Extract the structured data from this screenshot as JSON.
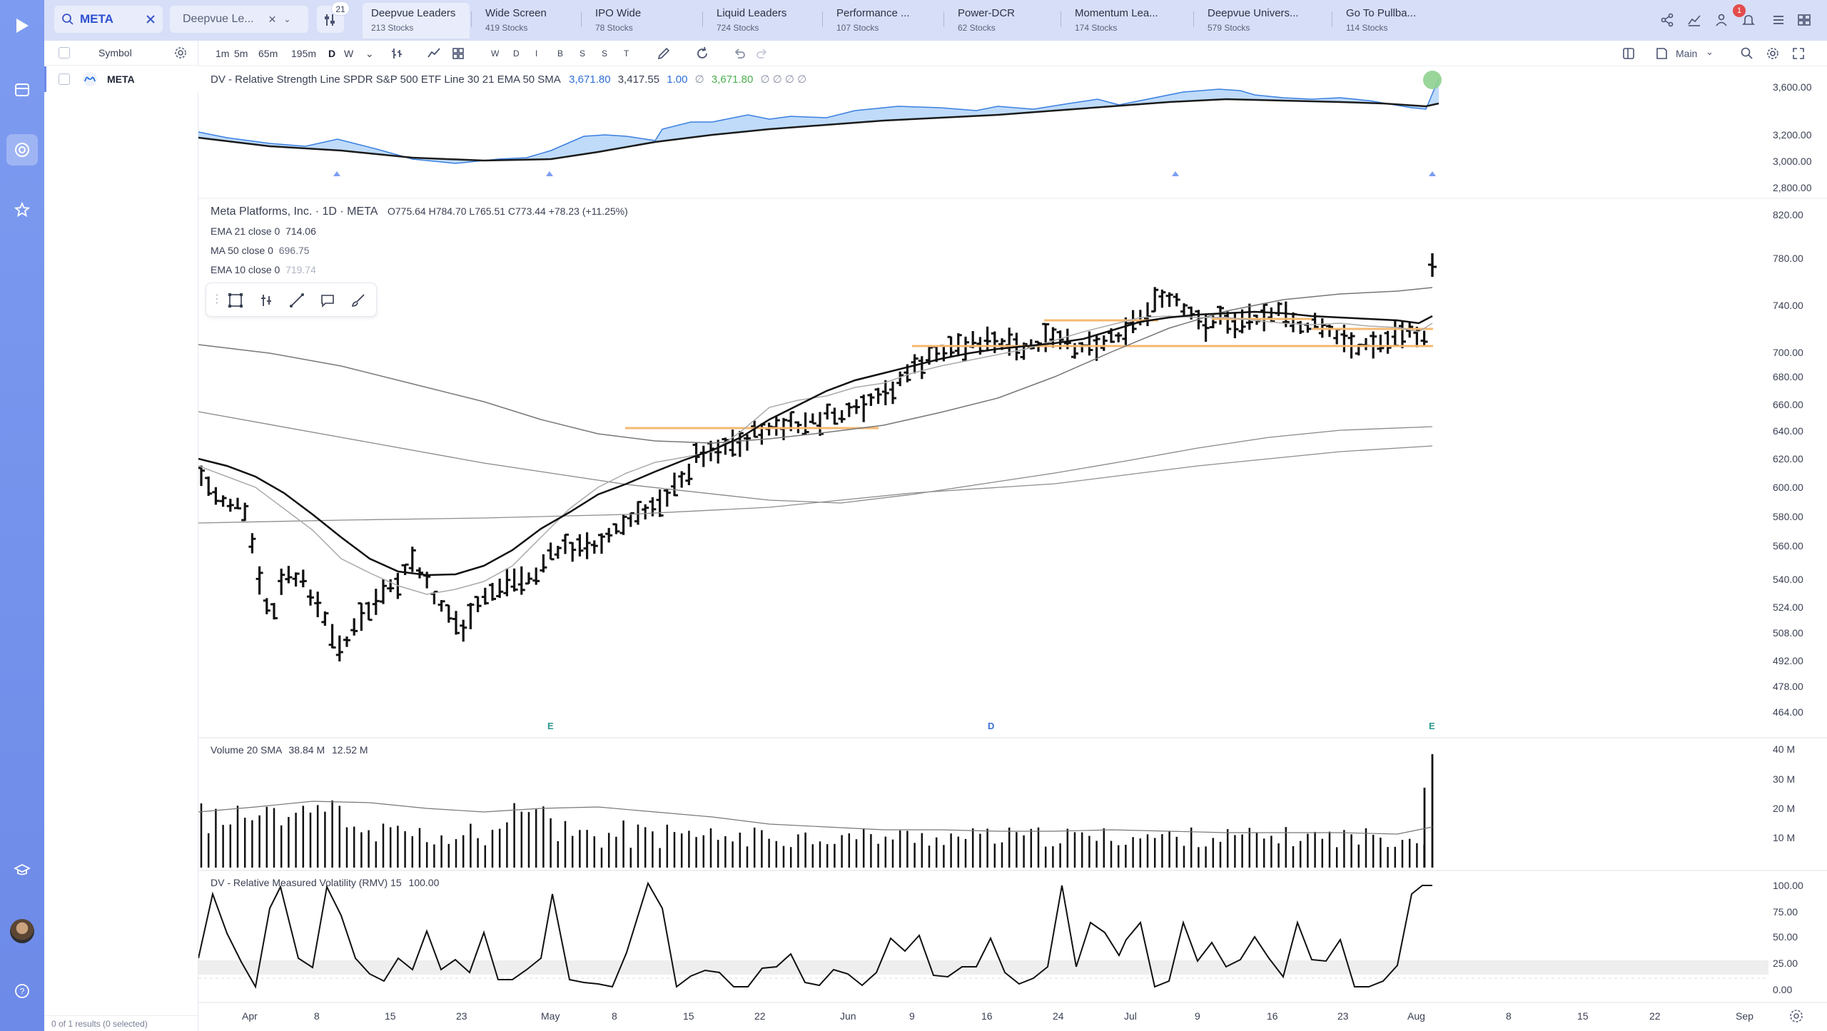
{
  "search": {
    "value": "META"
  },
  "list_select": {
    "value": "Deepvue Le..."
  },
  "filter": {
    "count": "21"
  },
  "tabs": [
    {
      "name": "Deepvue Leaders",
      "count": "213 Stocks",
      "active": true
    },
    {
      "name": "Wide Screen",
      "count": "419 Stocks"
    },
    {
      "name": "IPO Wide",
      "count": "78 Stocks"
    },
    {
      "name": "Liquid Leaders",
      "count": "724 Stocks"
    },
    {
      "name": "Performance ...",
      "count": "107 Stocks"
    },
    {
      "name": "Power-DCR",
      "count": "62 Stocks"
    },
    {
      "name": "Momentum Lea...",
      "count": "174 Stocks"
    },
    {
      "name": "Deepvue Univers...",
      "count": "579 Stocks"
    },
    {
      "name": "Go To Pullba...",
      "count": "114 Stocks"
    }
  ],
  "notifications": {
    "count": "1"
  },
  "watchlist": {
    "header": "Symbol",
    "rows": [
      {
        "symbol": "META"
      }
    ],
    "footer": "0 of 1 results (0 selected)"
  },
  "toolbar": {
    "timeframes": [
      "1m",
      "5m",
      "65m",
      "195m",
      "D",
      "W"
    ],
    "active_timeframe": "D",
    "periods": [
      "W",
      "D",
      "I",
      "B",
      "S",
      "S",
      "T"
    ],
    "layout_label": "Main"
  },
  "rs_panel": {
    "legend": "DV - Relative Strength Line SPDR S&P 500 ETF Line 30 21 EMA 50 SMA",
    "v1": "3,671.80",
    "v2": "3,417.55",
    "v3": "1.00",
    "v4": "3,671.80",
    "yticks": [
      "3,600.00",
      "3,200.00",
      "3,000.00",
      "2,800.00"
    ]
  },
  "price_panel": {
    "title": "Meta Platforms, Inc. · 1D · META",
    "ohlc": "O775.64  H784.70  L765.51  C773.44  +78.23 (+11.25%)",
    "ma_lines": [
      {
        "label": "EMA 21 close 0",
        "value": "714.06"
      },
      {
        "label": "MA 50 close 0",
        "value": "696.75"
      },
      {
        "label": "EMA 10 close 0",
        "value": "719.74"
      }
    ],
    "yticks": [
      "820.00",
      "780.00",
      "740.00",
      "700.00",
      "680.00",
      "660.00",
      "640.00",
      "620.00",
      "600.00",
      "580.00",
      "560.00",
      "540.00",
      "524.00",
      "508.00",
      "492.00",
      "478.00",
      "464.00"
    ],
    "event_markers": [
      "E",
      "D",
      "E"
    ]
  },
  "volume_panel": {
    "legend": "Volume 20 SMA",
    "v1": "38.84 M",
    "v2": "12.52 M",
    "yticks": [
      "40 M",
      "30 M",
      "20 M",
      "10 M"
    ]
  },
  "rmv_panel": {
    "legend": "DV - Relative Measured Volatility (RMV) 15",
    "value": "100.00",
    "yticks": [
      "100.00",
      "75.00",
      "50.00",
      "25.00",
      "0.00"
    ]
  },
  "x_axis": [
    "Apr",
    "8",
    "15",
    "23",
    "May",
    "8",
    "15",
    "22",
    "Jun",
    "9",
    "16",
    "24",
    "Jul",
    "9",
    "16",
    "23",
    "Aug",
    "8",
    "15",
    "22",
    "Sep"
  ],
  "colors": {
    "rail": "#7d9bf0",
    "topbar": "#d7def7",
    "rs_fill": "#a9cff7",
    "level_line": "#f5b871",
    "ema_e": "#2b9a8f",
    "marker_d": "#3a6fd8"
  }
}
